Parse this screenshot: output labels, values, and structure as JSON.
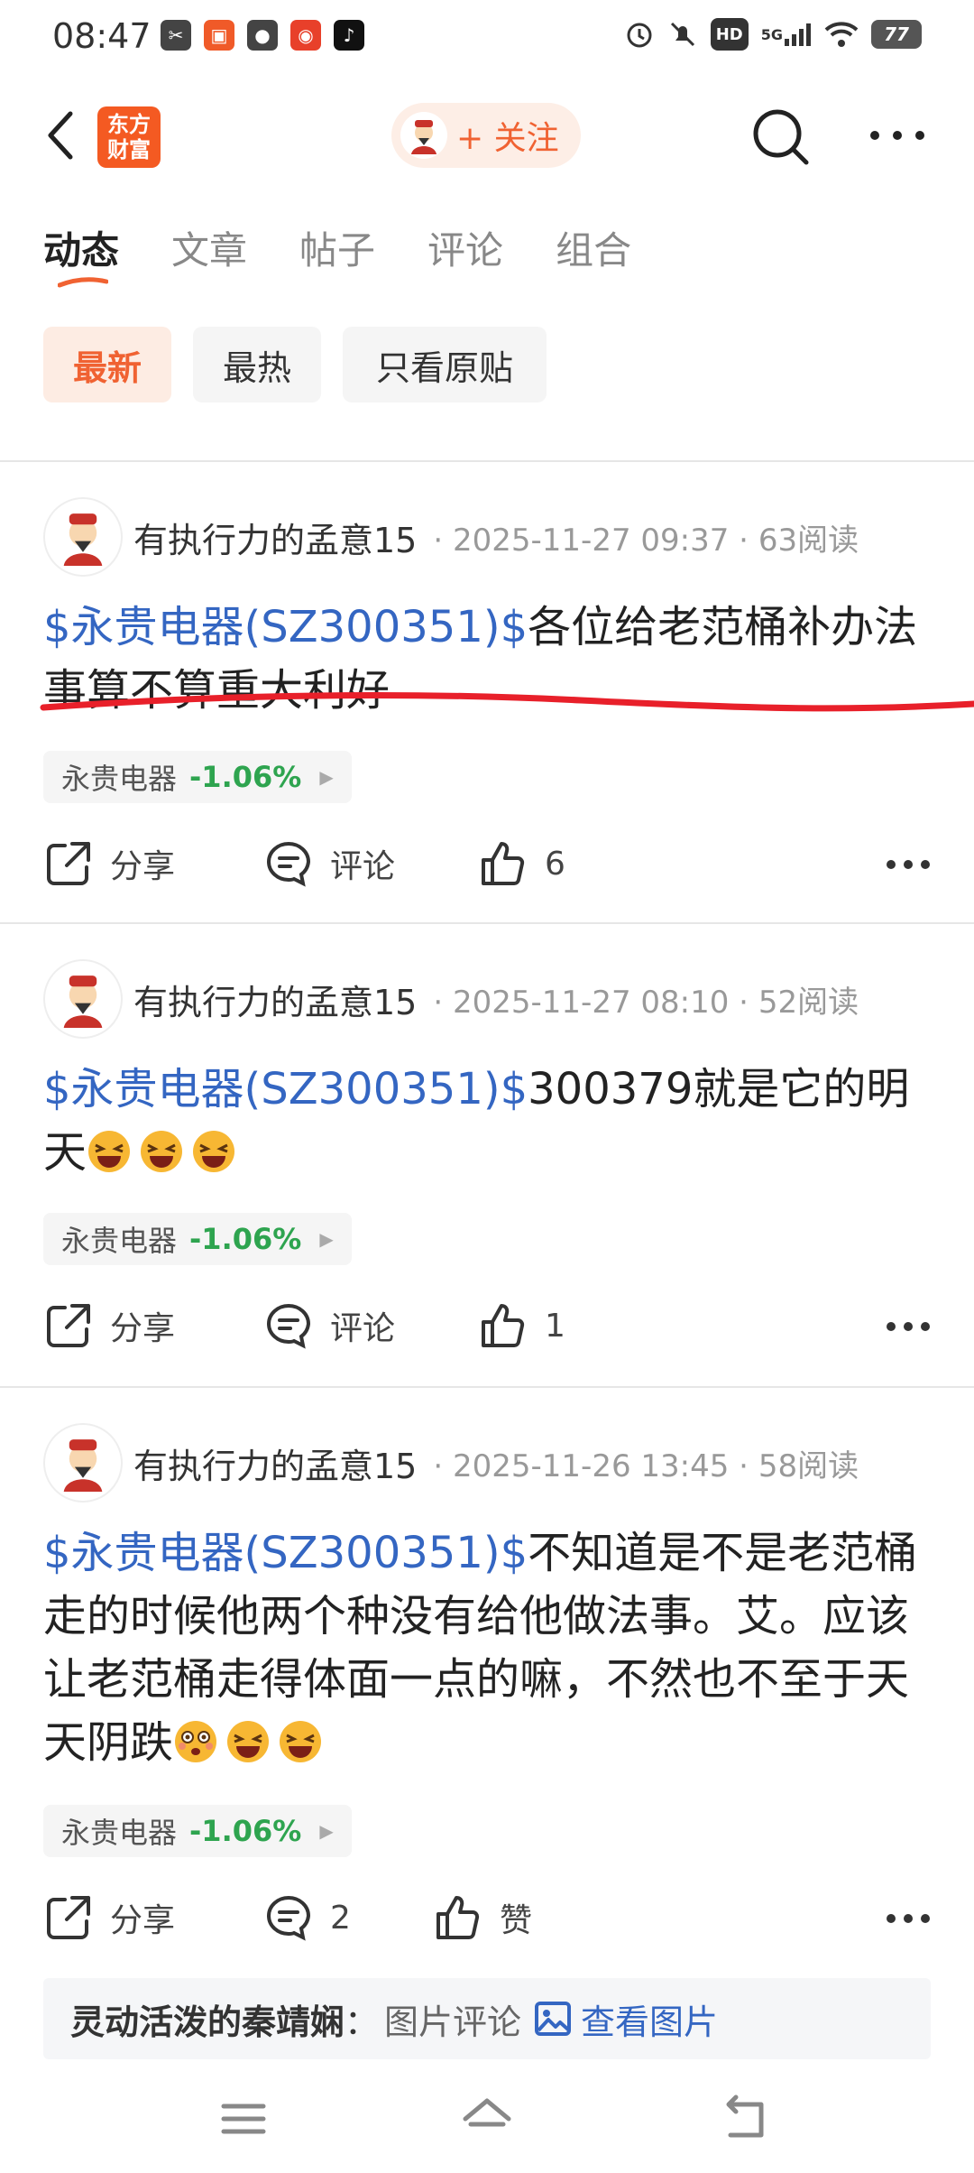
{
  "status_bar": {
    "time": "08:47",
    "battery": "77",
    "network": "5G",
    "hd": "HD",
    "app_icons": [
      "scissors-app-icon",
      "orange-app-icon",
      "wechat-icon",
      "listen-app-icon",
      "tiktok-icon"
    ]
  },
  "header": {
    "logo_line1": "东方",
    "logo_line2": "财富",
    "follow_label": "+ 关注"
  },
  "tabs": [
    {
      "label": "动态",
      "active": true
    },
    {
      "label": "文章",
      "active": false
    },
    {
      "label": "帖子",
      "active": false
    },
    {
      "label": "评论",
      "active": false
    },
    {
      "label": "组合",
      "active": false
    }
  ],
  "filters": [
    {
      "label": "最新",
      "active": true
    },
    {
      "label": "最热",
      "active": false
    },
    {
      "label": "只看原贴",
      "active": false
    }
  ],
  "posts": [
    {
      "author": "有执行力的孟意15",
      "datetime": "2025-11-27 09:37",
      "reads": "63阅读",
      "stock_link": "$永贵电器(SZ300351)$",
      "text": "各位给老范桶补办法事算不算重大利好",
      "stock_name": "永贵电器",
      "stock_change": "-1.06%",
      "share": "分享",
      "comment": "评论",
      "likes": "6"
    },
    {
      "author": "有执行力的孟意15",
      "datetime": "2025-11-27 08:10",
      "reads": "52阅读",
      "stock_link": "$永贵电器(SZ300351)$",
      "text": "300379就是它的明天",
      "stock_name": "永贵电器",
      "stock_change": "-1.06%",
      "share": "分享",
      "comment": "评论",
      "likes": "1"
    },
    {
      "author": "有执行力的孟意15",
      "datetime": "2025-11-26 13:45",
      "reads": "58阅读",
      "stock_link": "$永贵电器(SZ300351)$",
      "text": "不知道是不是老范桶走的时候他两个种没有给他做法事。艾。应该让老范桶走得体面一点的嘛，不然也不至于天天阴跌",
      "stock_name": "永贵电器",
      "stock_change": "-1.06%",
      "share": "分享",
      "comment": "2",
      "likes": "赞"
    }
  ],
  "comment_preview": {
    "user": "灵动活泼的秦靖娴",
    "separator": "：",
    "type": "图片评论",
    "view_label": "查看图片"
  },
  "colors": {
    "accent": "#f06232",
    "link": "#3466c2",
    "down": "#2ea44f",
    "annotation": "#e8202a"
  }
}
